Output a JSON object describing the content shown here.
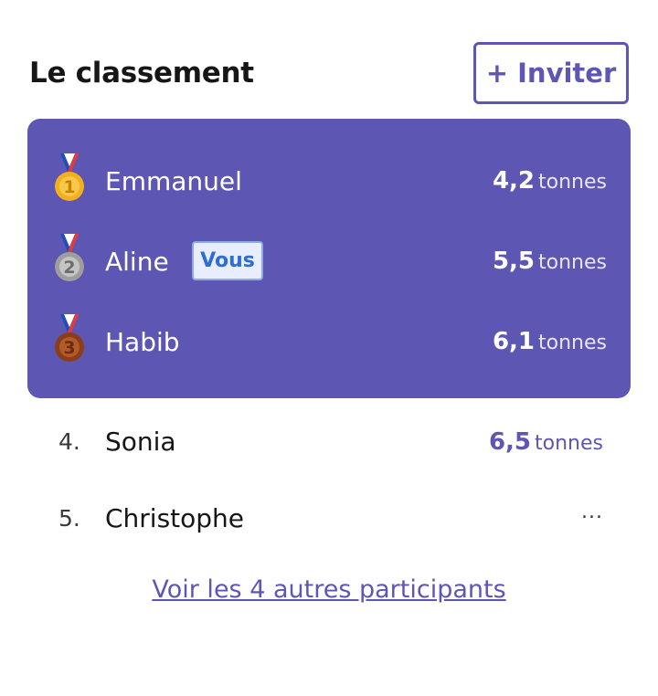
{
  "header": {
    "title": "Le classement",
    "invite_label": "+ Inviter"
  },
  "podium": [
    {
      "rank_icon": "gold-medal-icon",
      "medal_number": "1",
      "name": "Emmanuel",
      "score": "4,2",
      "unit": "tonnes",
      "is_you": false
    },
    {
      "rank_icon": "silver-medal-icon",
      "medal_number": "2",
      "name": "Aline",
      "score": "5,5",
      "unit": "tonnes",
      "is_you": true,
      "you_label": "Vous"
    },
    {
      "rank_icon": "bronze-medal-icon",
      "medal_number": "3",
      "name": "Habib",
      "score": "6,1",
      "unit": "tonnes",
      "is_you": false
    }
  ],
  "list": [
    {
      "rank": "4.",
      "name": "Sonia",
      "score": "6,5",
      "unit": "tonnes"
    },
    {
      "rank": "5.",
      "name": "Christophe",
      "score_placeholder": "..."
    }
  ],
  "more_link": "Voir les 4 autres participants",
  "colors": {
    "accent": "#5d56b5",
    "podium_bg": "#5d56b3",
    "gold": "#f2b01e",
    "silver": "#a5a5a5",
    "bronze": "#a0522d"
  }
}
